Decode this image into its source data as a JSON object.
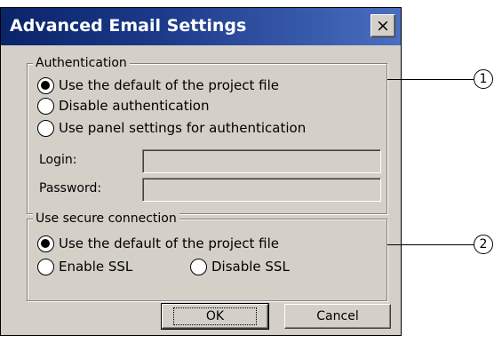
{
  "dialog": {
    "title": "Advanced Email Settings",
    "close_label": "×"
  },
  "authentication": {
    "legend": "Authentication",
    "options": [
      {
        "label": "Use the default of the project file",
        "checked": true
      },
      {
        "label": "Disable authentication",
        "checked": false
      },
      {
        "label": "Use panel settings for authentication",
        "checked": false
      }
    ],
    "login_label": "Login:",
    "login_value": "",
    "password_label": "Password:",
    "password_value": ""
  },
  "secure_connection": {
    "legend": "Use secure connection",
    "options": [
      {
        "label": "Use the default of the project file",
        "checked": true
      },
      {
        "label": "Enable SSL",
        "checked": false
      },
      {
        "label": "Disable SSL",
        "checked": false
      }
    ]
  },
  "buttons": {
    "ok": "OK",
    "cancel": "Cancel"
  },
  "callouts": [
    "1",
    "2"
  ]
}
